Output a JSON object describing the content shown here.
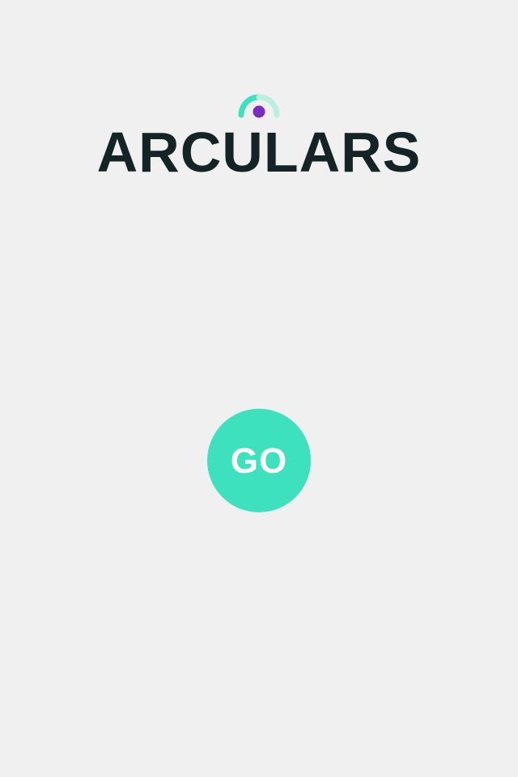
{
  "app": {
    "title": "ARCULARS",
    "logo_icon": "arc-with-dot-icon"
  },
  "start_button": {
    "label": "GO"
  },
  "colors": {
    "background": "#f0f0f0",
    "title": "#132326",
    "accent": "#3ee1bd",
    "arc_light": "#bdeee2",
    "dot": "#7a2bc2",
    "button_text": "#ffffff"
  }
}
